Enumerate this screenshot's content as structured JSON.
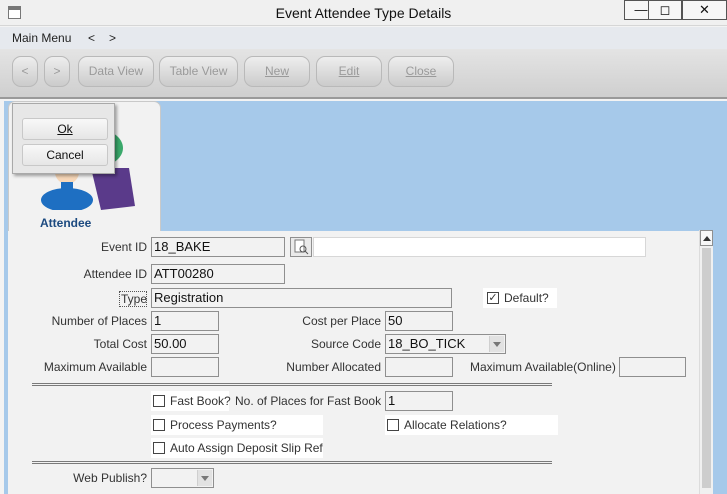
{
  "window": {
    "title": "Event Attendee Type Details",
    "minimize_glyph": "—",
    "maximize_glyph": "◻",
    "close_glyph": "✕"
  },
  "menu": {
    "main": "Main Menu",
    "back": "<",
    "forward": ">"
  },
  "toolbar": {
    "back": "<",
    "forward": ">",
    "data_view": "Data View",
    "table_view": "Table View",
    "new": "New",
    "edit": "Edit",
    "close": "Close"
  },
  "popup": {
    "ok": "Ok",
    "cancel": "Cancel"
  },
  "tab": {
    "label": "Attendee",
    "icon": "attendee-person-icon"
  },
  "form": {
    "event_id": {
      "label": "Event ID",
      "value": "18_BAKE",
      "description": ""
    },
    "attendee_id": {
      "label": "Attendee ID",
      "value": "ATT00280"
    },
    "type": {
      "label": "Type",
      "value": "Registration"
    },
    "default": {
      "label": "Default?",
      "checked": true,
      "mark": "✓"
    },
    "number_of_places": {
      "label": "Number of Places",
      "value": "1"
    },
    "cost_per_place": {
      "label": "Cost per Place",
      "value": "50"
    },
    "total_cost": {
      "label": "Total Cost",
      "value": "50.00"
    },
    "source_code": {
      "label": "Source Code",
      "value": "18_BO_TICK"
    },
    "maximum_available": {
      "label": "Maximum Available",
      "value": ""
    },
    "number_allocated": {
      "label": "Number Allocated",
      "value": ""
    },
    "maximum_available_online": {
      "label": "Maximum Available(Online)",
      "value": ""
    },
    "fast_book": {
      "label": "Fast Book?",
      "checked": false
    },
    "places_fast_book": {
      "label": "No. of Places for Fast Book",
      "value": "1"
    },
    "process_payments": {
      "label": "Process Payments?",
      "checked": false
    },
    "allocate_relations": {
      "label": "Allocate Relations?",
      "checked": false
    },
    "auto_assign": {
      "label": "Auto Assign Deposit Slip Ref",
      "checked": false
    },
    "web_publish": {
      "label": "Web Publish?",
      "value": ""
    }
  },
  "colors": {
    "content_bg": "#a6c9ea",
    "tab_label": "#1c4a80",
    "icon_green": "#3aa86b",
    "icon_blue": "#1e6fc2",
    "icon_purple": "#5a3a8a"
  }
}
